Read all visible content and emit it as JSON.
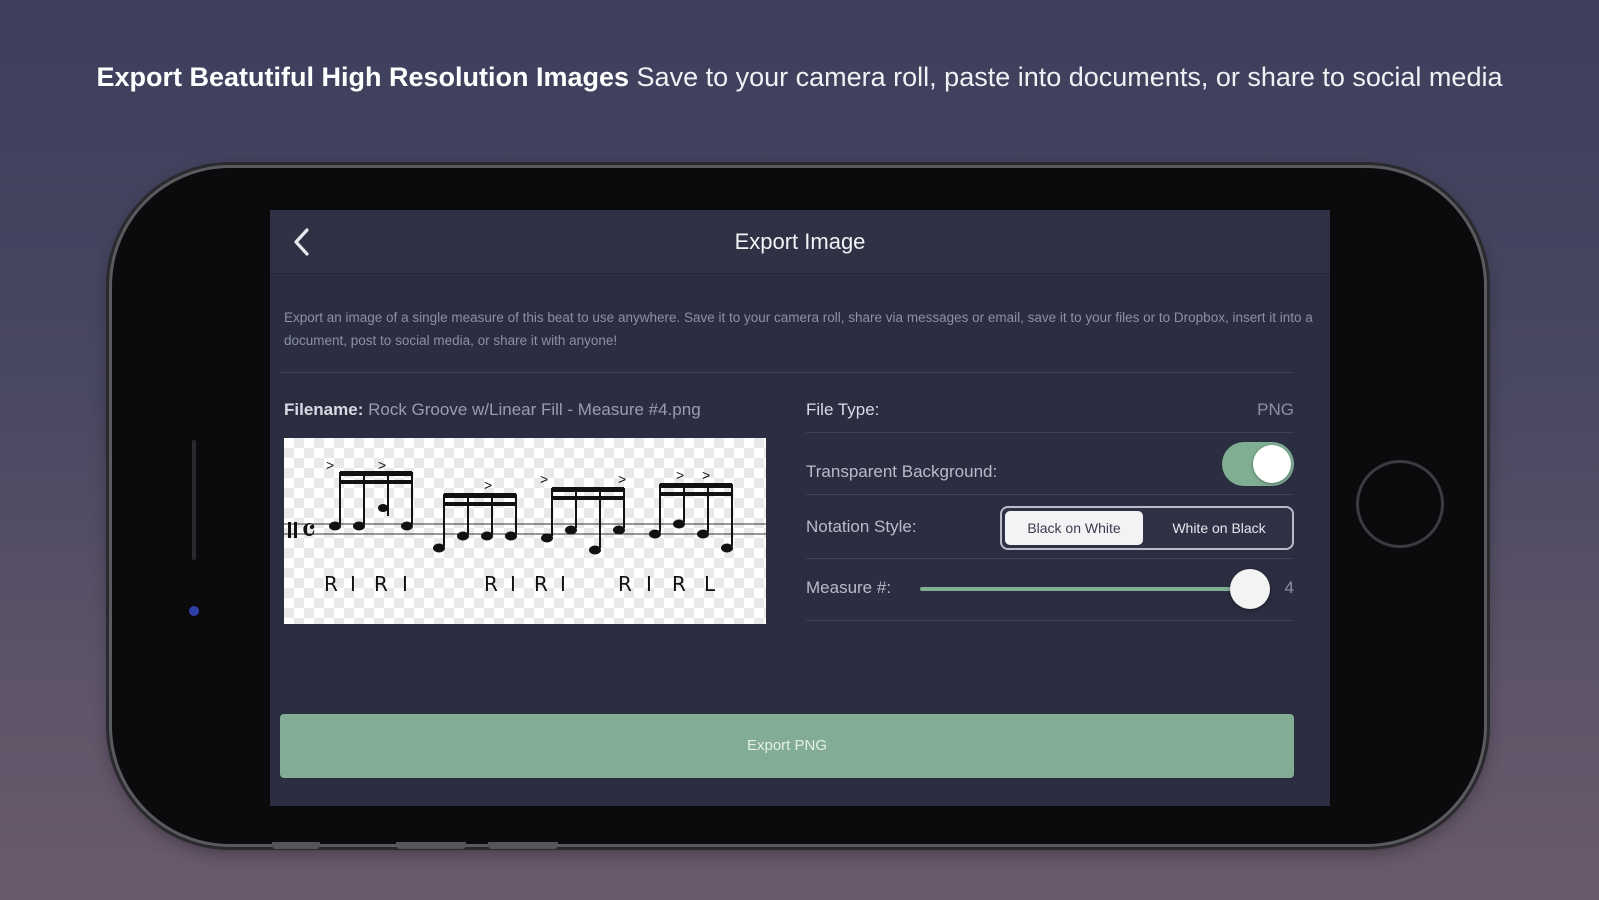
{
  "headline": {
    "bold": "Export Beatutiful High Resolution Images",
    "rest": " Save to your camera roll, paste into documents, or share to social media"
  },
  "navbar": {
    "back_icon": "chevron-left-icon",
    "title": "Export Image"
  },
  "description": "Export an image of a single measure of this beat to use anywhere. Save it to your camera roll, share via messages or email, save it to your files or to Dropbox, insert it into a document, post to social media, or share it with anyone!",
  "filename": {
    "label": "Filename:",
    "value": " Rock Groove w/Linear Fill - Measure #4.png"
  },
  "preview": {
    "sticking": [
      "R",
      "I",
      "R",
      "I",
      "R",
      "I",
      "R",
      "I",
      "R",
      "I",
      "R",
      "L"
    ]
  },
  "settings": {
    "file_type": {
      "label": "File Type:",
      "value": "PNG"
    },
    "transparent_background": {
      "label": "Transparent Background:",
      "enabled": true
    },
    "notation_style": {
      "label": "Notation Style:",
      "options": [
        "Black on White",
        "White on Black"
      ],
      "selected": "Black on White"
    },
    "measure": {
      "label": "Measure #:",
      "value": "4",
      "fraction": 1.0
    }
  },
  "export_button": {
    "label": "Export PNG"
  },
  "colors": {
    "accent": "#82ad94",
    "screen_bg": "#2b2e40",
    "navbar_bg": "#2f3245"
  }
}
